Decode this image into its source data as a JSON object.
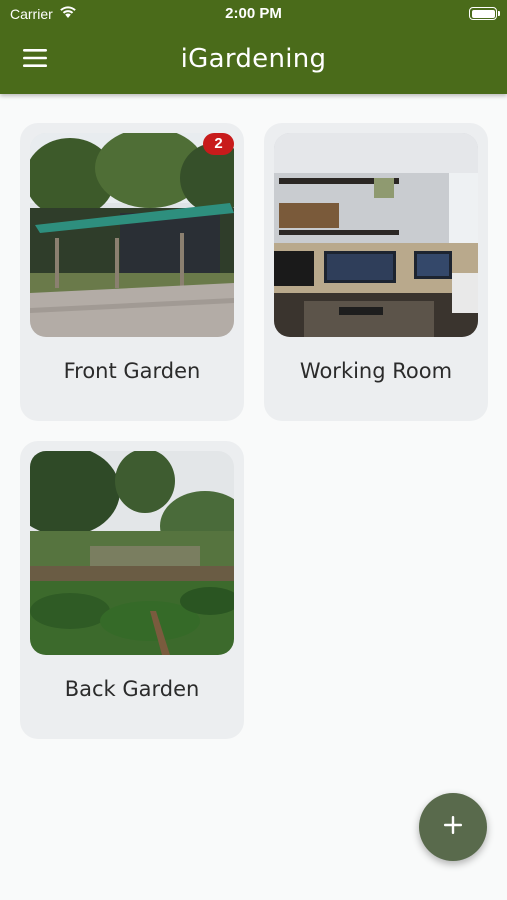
{
  "status_bar": {
    "carrier": "Carrier",
    "time": "2:00 PM",
    "wifi_icon": "wifi-icon",
    "battery_icon": "battery-icon"
  },
  "app_bar": {
    "title": "iGardening",
    "menu_icon": "hamburger-menu-icon",
    "background_color": "#4a6b1a"
  },
  "gardens": [
    {
      "name": "Front Garden",
      "badge": "2",
      "photo": "front-garden-photo"
    },
    {
      "name": "Working Room",
      "photo": "working-room-photo"
    },
    {
      "name": "Back Garden",
      "photo": "back-garden-photo"
    }
  ],
  "fab": {
    "icon": "plus-icon",
    "color": "#596a4c"
  },
  "colors": {
    "badge": "#c81b1b",
    "card_background": "#eceef0",
    "page_background": "#f9fafa"
  }
}
